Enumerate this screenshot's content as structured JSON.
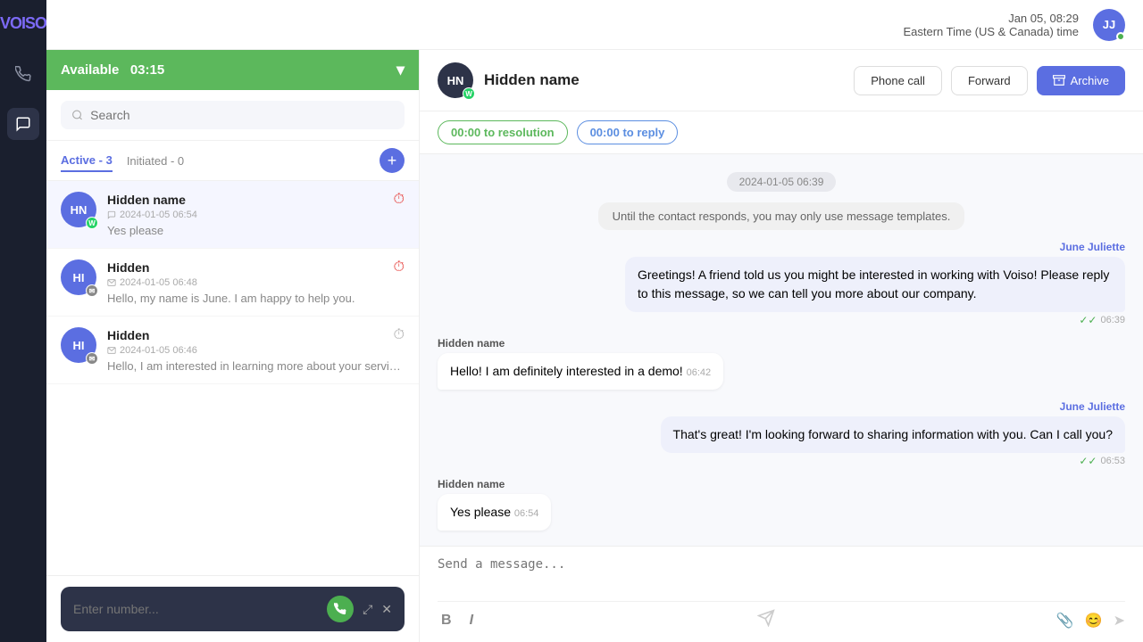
{
  "logo": "VOISO",
  "topHeader": {
    "date": "Jan 05, 08:29",
    "timezone": "Eastern Time (US & Canada) time",
    "avatarInitials": "JJ"
  },
  "statusBar": {
    "label": "Available",
    "time": "03:15",
    "chevron": "▾"
  },
  "search": {
    "placeholder": "Search"
  },
  "tabs": [
    {
      "label": "Active",
      "count": 3,
      "suffix": "- 3"
    },
    {
      "label": "Initiated",
      "count": 0,
      "suffix": "- 0"
    }
  ],
  "addBtn": "+",
  "conversations": [
    {
      "initials": "HN",
      "name": "Hidden name",
      "date": "2024-01-05 06:54",
      "preview": "Yes please",
      "channel": "whatsapp",
      "clockColor": "red"
    },
    {
      "initials": "HI",
      "name": "Hidden",
      "date": "2024-01-05 06:48",
      "preview": "Hello, my name is June. I am happy to help you.",
      "channel": "sms",
      "clockColor": "red"
    },
    {
      "initials": "HI",
      "name": "Hidden",
      "date": "2024-01-05 06:46",
      "preview": "Hello, I am interested in learning more about your services.",
      "channel": "sms",
      "clockColor": "grey"
    }
  ],
  "dial": {
    "placeholder": "Enter number...",
    "callIcon": "📞",
    "expandIcon": "⤢",
    "closeIcon": "✕"
  },
  "chat": {
    "contactInitials": "HN",
    "contactName": "Hidden name",
    "timerResolution": "00:00 to resolution",
    "timerReply": "00:00 to reply",
    "actions": {
      "phoneCall": "Phone call",
      "forward": "Forward",
      "archive": "Archive"
    },
    "dateDivider": "2024-01-05 06:39",
    "systemMsg": "Until the contact responds, you may only use message templates.",
    "messages": [
      {
        "id": 1,
        "type": "outgoing",
        "sender": "June Juliette",
        "text": "Greetings! A friend told us you might be interested in working with Voiso! Please reply to this message, so we can tell you more about our company.",
        "time": "06:39",
        "doubleCheck": true
      },
      {
        "id": 2,
        "type": "incoming",
        "sender": "Hidden name",
        "text": "Hello! I am definitely interested in a demo!",
        "time": "06:42",
        "doubleCheck": false
      },
      {
        "id": 3,
        "type": "outgoing",
        "sender": "June Juliette",
        "text": "That's great! I'm looking forward to sharing information with you. Can I call you?",
        "time": "06:53",
        "doubleCheck": true
      },
      {
        "id": 4,
        "type": "incoming",
        "sender": "Hidden name",
        "text": "Yes please",
        "time": "06:54",
        "doubleCheck": false
      }
    ],
    "inputPlaceholder": "Send a message...",
    "toolbar": {
      "bold": "B",
      "italic": "I"
    }
  }
}
